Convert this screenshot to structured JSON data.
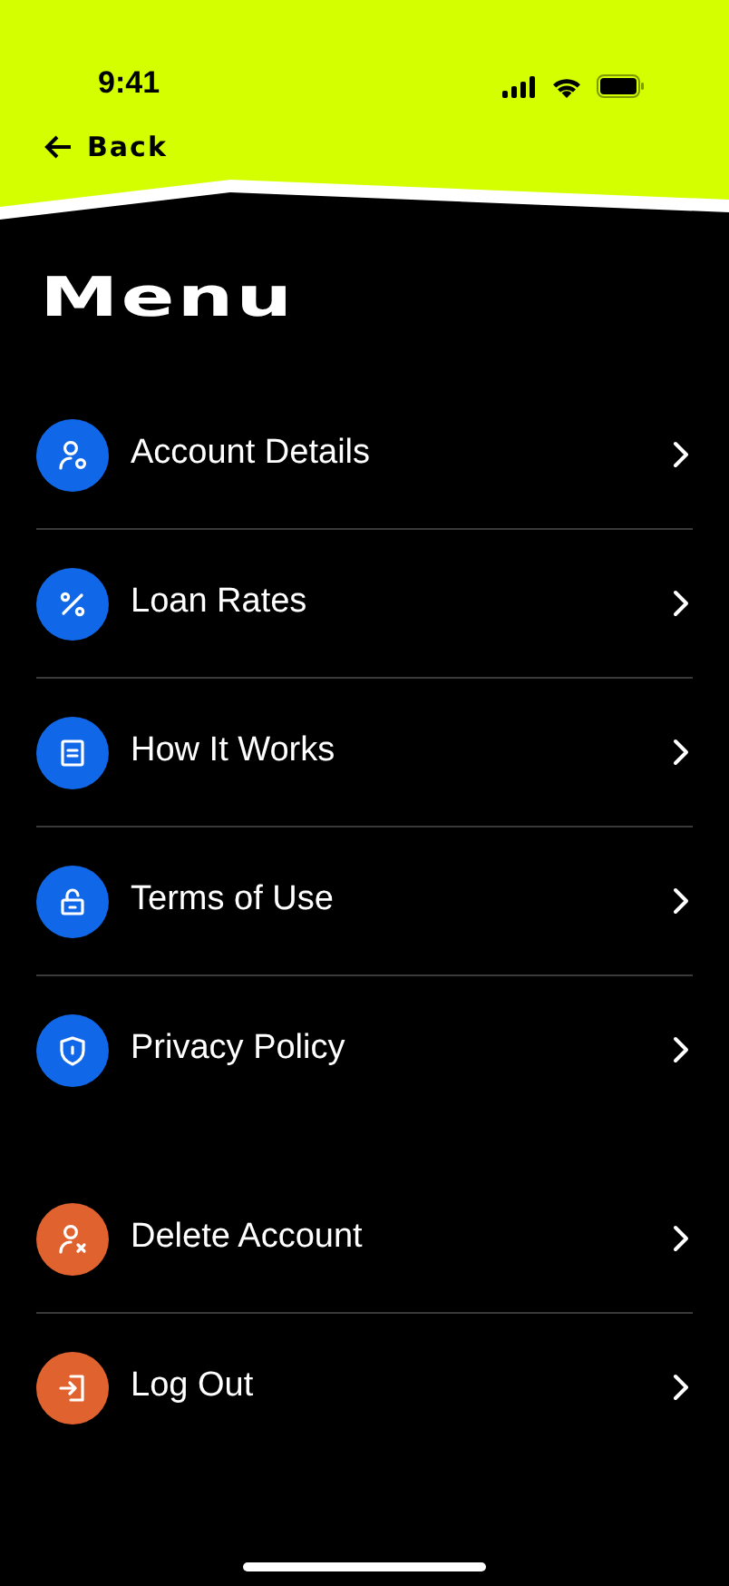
{
  "status_bar": {
    "time": "9:41"
  },
  "header": {
    "back_label": "Back"
  },
  "title": "Menu",
  "groups": [
    {
      "items": [
        {
          "label": "Account Details",
          "kind": "user-settings",
          "color": "#1068e8"
        },
        {
          "label": "Loan Rates",
          "kind": "percent",
          "color": "#1068e8"
        },
        {
          "label": "How It Works",
          "kind": "document",
          "color": "#1068e8"
        },
        {
          "label": "Terms of Use",
          "kind": "lock",
          "color": "#1068e8"
        },
        {
          "label": "Privacy Policy",
          "kind": "shield",
          "color": "#1068e8"
        }
      ]
    },
    {
      "items": [
        {
          "label": "Delete Account",
          "kind": "user-remove",
          "color": "#e0622f"
        },
        {
          "label": "Log Out",
          "kind": "login",
          "color": "#e0622f"
        }
      ]
    }
  ]
}
